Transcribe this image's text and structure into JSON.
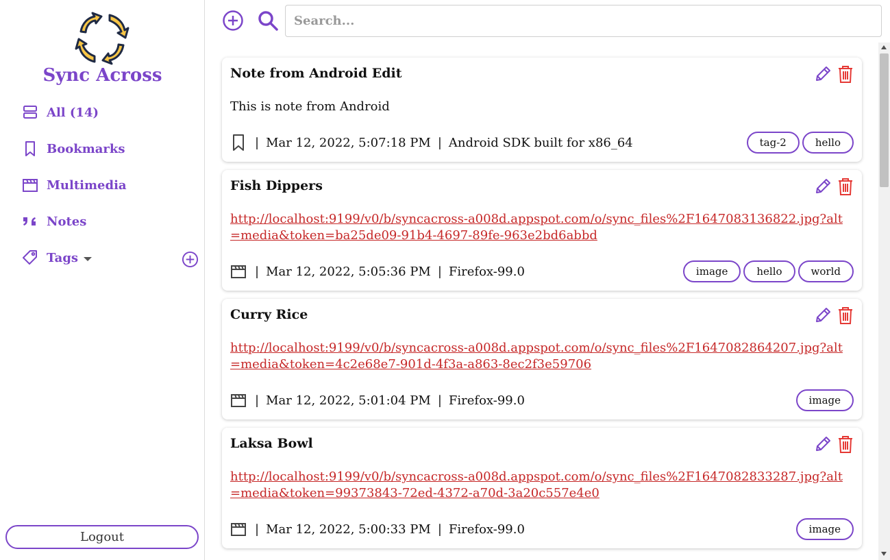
{
  "app": {
    "name": "Sync Across",
    "brand_color": "#7b45c9",
    "link_color": "#c62828",
    "delete_color": "#e53935"
  },
  "sidebar": {
    "items": [
      {
        "label": "All (14)",
        "icon": "stack-icon"
      },
      {
        "label": "Bookmarks",
        "icon": "bookmark-icon"
      },
      {
        "label": "Multimedia",
        "icon": "clapperboard-icon"
      },
      {
        "label": "Notes",
        "icon": "quote-icon"
      },
      {
        "label": "Tags",
        "icon": "tag-icon"
      }
    ],
    "logout_label": "Logout"
  },
  "search": {
    "placeholder": "Search...",
    "value": ""
  },
  "items": [
    {
      "title": "Note from Android Edit",
      "body": "This is note from Android",
      "type_icon": "bookmark-icon",
      "date": "Mar 12, 2022, 5:07:18 PM",
      "device": "Android SDK built for x86_64",
      "tags": [
        "tag-2",
        "hello"
      ]
    },
    {
      "title": "Fish Dippers",
      "body": "http://localhost:9199/v0/b/syncacross-a008d.appspot.com/o/sync_files%2F1647083136822.jpg?alt=media&token=ba25de09-91b4-4697-89fe-963e2bd6abbd",
      "type_icon": "clapperboard-icon",
      "date": "Mar 12, 2022, 5:05:36 PM",
      "device": "Firefox-99.0",
      "tags": [
        "image",
        "hello",
        "world"
      ]
    },
    {
      "title": "Curry Rice",
      "body": "http://localhost:9199/v0/b/syncacross-a008d.appspot.com/o/sync_files%2F1647082864207.jpg?alt=media&token=4c2e68e7-901d-4f3a-a863-8ec2f3e59706",
      "type_icon": "clapperboard-icon",
      "date": "Mar 12, 2022, 5:01:04 PM",
      "device": "Firefox-99.0",
      "tags": [
        "image"
      ]
    },
    {
      "title": "Laksa Bowl",
      "body": "http://localhost:9199/v0/b/syncacross-a008d.appspot.com/o/sync_files%2F1647082833287.jpg?alt=media&token=99373843-72ed-4372-a70d-3a20c557e4e0",
      "type_icon": "clapperboard-icon",
      "date": "Mar 12, 2022, 5:00:33 PM",
      "device": "Firefox-99.0",
      "tags": [
        "image"
      ]
    }
  ]
}
